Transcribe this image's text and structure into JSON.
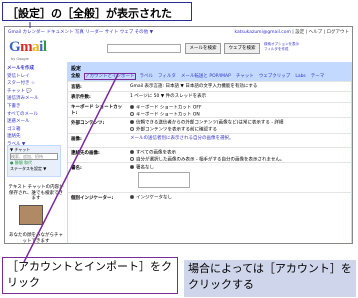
{
  "captions": {
    "top": "［設定］の［全般］が表示された",
    "left_callout": "［アカウントとインポート］をクリック",
    "right_callout": "場合によっては［アカウント］をクリックする"
  },
  "gmail": {
    "topbar_left": "Gmail カレンダー ドキュメント 写真 リーダー サイト ウェブ その他 ▼",
    "topbar_user": "katsukazumi@gmail.com",
    "topbar_right_links": "| 設定 | ヘルプ | ログアウト",
    "logo_text": [
      "G",
      "m",
      "a",
      "i",
      "l"
    ],
    "logo_sub": "by Google",
    "search_button": "メールを検索",
    "web_search_button": "ウェブを検索",
    "search_links": [
      "検索オプションを表示",
      "フィルタを作成"
    ],
    "nav": [
      {
        "label": "メールを作成",
        "type": "compose"
      },
      {
        "label": "受信トレイ"
      },
      {
        "label": "スター付き ☆"
      },
      {
        "label": "チャット 💬"
      },
      {
        "label": "送信済みメール"
      },
      {
        "label": "下書き"
      },
      {
        "label": "すべてのメール"
      },
      {
        "label": "迷惑メール"
      },
      {
        "label": "ゴミ箱"
      },
      {
        "label": "連絡先"
      },
      {
        "label": "ラベル ▼"
      }
    ],
    "chat": {
      "title": "▼ チャット",
      "search": "検索、追加、招待",
      "status": "● 勝間 和代",
      "status_note": "ステータスを設定 ▼"
    },
    "photo_caption": "テキスト チャットの内容が保存され、誰でも検索できます",
    "ad_caption": "あなたの顔をみながらチャットできます",
    "settings": {
      "title": "設定",
      "tabs": [
        {
          "label": "全般",
          "current": true
        },
        {
          "label": "アカウントとインポート",
          "highlight": true
        },
        {
          "label": "ラベル"
        },
        {
          "label": "フィルタ"
        },
        {
          "label": "メール転送と POP/IMAP"
        },
        {
          "label": "チャット"
        },
        {
          "label": "ウェブクリップ"
        },
        {
          "label": "Labs"
        },
        {
          "label": "テーマ"
        }
      ],
      "rows": [
        {
          "label": "言語:",
          "lines": [
            "Gmail 表示言語: 日本語 ▼ 日本語の文字入力機能を有効にする"
          ]
        },
        {
          "label": "表示件数:",
          "lines": [
            "1 ページに 50 ▼ 件のスレッドを表示"
          ]
        },
        {
          "label": "キーボード ショートカット:",
          "lines": [
            "キーボード ショートカット OFF",
            "キーボード ショートカット ON"
          ]
        },
        {
          "label": "外部コンテンツ:",
          "lines": [
            "信頼できる送信者からの外部コンテンツ(画像など)は常に表示する - 詳細",
            "外部コンテンツを表示する前に確認する"
          ]
        },
        {
          "label": "画像:",
          "lines": [
            "メールの送信者別に表示される自分の画像を選択。"
          ]
        },
        {
          "label": "連絡先の画像:",
          "lines": [
            "すべての画像を表示",
            "自分が選択した画像のみ表示 - 相手がする自分の画像を表示されません。"
          ]
        },
        {
          "label": "署名:",
          "lines": [
            "署名なし"
          ]
        },
        {
          "label": "個別インジケーター:",
          "lines": [
            "インジケータなし"
          ]
        }
      ]
    }
  },
  "colors": {
    "callout_border": "#7b2a9a",
    "caption_border": "#2b2f8f",
    "settings_header": "#c3d9ff",
    "link": "#3333cc"
  }
}
